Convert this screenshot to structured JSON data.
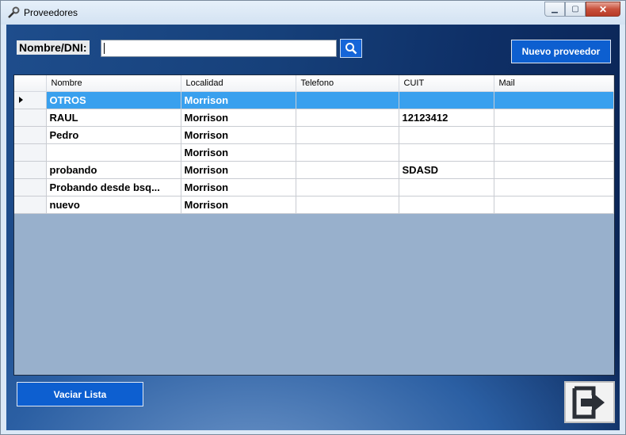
{
  "window": {
    "title": "Proveedores"
  },
  "search": {
    "label": "Nombre/DNI:",
    "value": "",
    "placeholder": ""
  },
  "buttons": {
    "new_provider": "Nuevo proveedor",
    "clear_list": "Vaciar Lista"
  },
  "grid": {
    "columns": [
      "Nombre",
      "Localidad",
      "Telefono",
      "CUIT",
      "Mail"
    ],
    "rows": [
      {
        "nombre": "OTROS",
        "localidad": "Morrison",
        "telefono": "",
        "cuit": "",
        "mail": "",
        "selected": true
      },
      {
        "nombre": "RAUL",
        "localidad": "Morrison",
        "telefono": "",
        "cuit": "12123412",
        "mail": ""
      },
      {
        "nombre": "Pedro",
        "localidad": "Morrison",
        "telefono": "",
        "cuit": "",
        "mail": ""
      },
      {
        "nombre": "",
        "localidad": "Morrison",
        "telefono": "",
        "cuit": "",
        "mail": ""
      },
      {
        "nombre": "probando",
        "localidad": "Morrison",
        "telefono": "",
        "cuit": "SDASD",
        "mail": ""
      },
      {
        "nombre": "Probando desde bsq...",
        "localidad": "Morrison",
        "telefono": "",
        "cuit": "",
        "mail": ""
      },
      {
        "nombre": "nuevo",
        "localidad": "Morrison",
        "telefono": "",
        "cuit": "",
        "mail": ""
      }
    ]
  },
  "icons": {
    "app": "tools-icon",
    "search": "magnifier-icon",
    "exit": "exit-arrow-icon"
  },
  "colors": {
    "selected_row": "#39a0ee",
    "button_blue": "#0d5fd0",
    "background_dark": "#0e2f66"
  }
}
